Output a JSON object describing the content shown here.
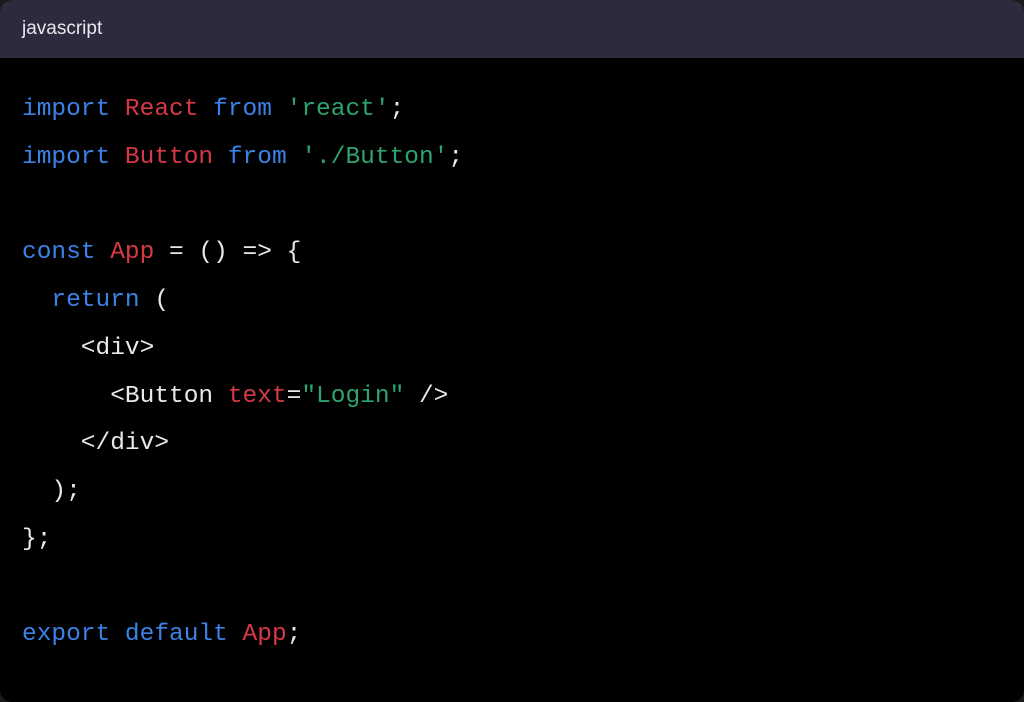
{
  "header": {
    "language": "javascript"
  },
  "code": {
    "line1": {
      "kw1": "import",
      "cls": "React",
      "kw2": "from",
      "str": "'react'",
      "semi": ";"
    },
    "line2": {
      "kw1": "import",
      "cls": "Button",
      "kw2": "from",
      "str": "'./Button'",
      "semi": ";"
    },
    "line4": {
      "kw": "const",
      "cls": "App",
      "rest": " = () => {"
    },
    "line5": {
      "indent": "  ",
      "kw": "return",
      "paren": " ("
    },
    "line6": {
      "text": "    <div>"
    },
    "line7": {
      "indent": "      <",
      "tag": "Button",
      "sp": " ",
      "attr": "text",
      "eq": "=",
      "val": "\"Login\"",
      "close": " />"
    },
    "line8": {
      "text": "    </div>"
    },
    "line9": {
      "text": "  );"
    },
    "line10": {
      "text": "};"
    },
    "line12": {
      "kw1": "export",
      "kw2": "default",
      "cls": "App",
      "semi": ";"
    }
  }
}
